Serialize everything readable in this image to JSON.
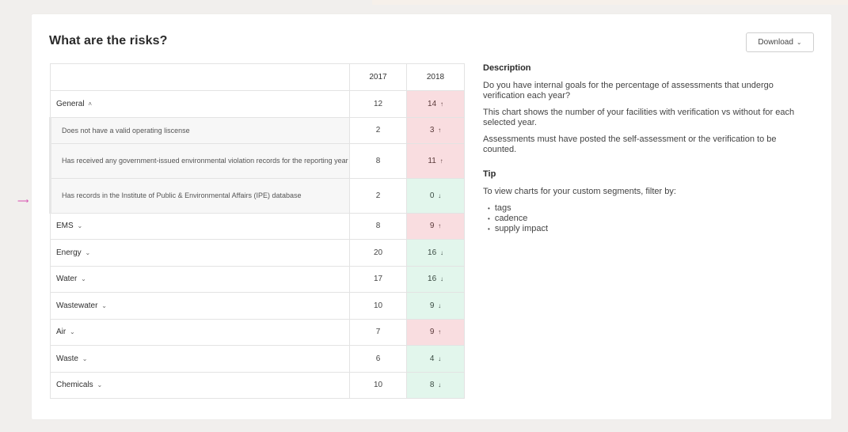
{
  "title": "What are the risks?",
  "download_label": "Download",
  "years": [
    "2017",
    "2018"
  ],
  "rows": [
    {
      "label": "General",
      "type": "cat",
      "expanded": true,
      "v2017": "12",
      "v2018": "14",
      "trend": "up"
    },
    {
      "label": "Does not have a valid operating liscense",
      "type": "sub",
      "v2017": "2",
      "v2018": "3",
      "trend": "up"
    },
    {
      "label": "Has received any government-issued environmental violation records for the reporting year",
      "type": "sub",
      "v2017": "8",
      "v2018": "11",
      "trend": "up"
    },
    {
      "label": "Has records in the Institute of Public & Environmental Affairs (IPE) database",
      "type": "sub",
      "v2017": "2",
      "v2018": "0",
      "trend": "down"
    },
    {
      "label": "EMS",
      "type": "cat",
      "expanded": false,
      "v2017": "8",
      "v2018": "9",
      "trend": "up"
    },
    {
      "label": "Energy",
      "type": "cat",
      "expanded": false,
      "v2017": "20",
      "v2018": "16",
      "trend": "down"
    },
    {
      "label": "Water",
      "type": "cat",
      "expanded": false,
      "v2017": "17",
      "v2018": "16",
      "trend": "down"
    },
    {
      "label": "Wastewater",
      "type": "cat",
      "expanded": false,
      "v2017": "10",
      "v2018": "9",
      "trend": "down"
    },
    {
      "label": "Air",
      "type": "cat",
      "expanded": false,
      "v2017": "7",
      "v2018": "9",
      "trend": "up"
    },
    {
      "label": "Waste",
      "type": "cat",
      "expanded": false,
      "v2017": "6",
      "v2018": "4",
      "trend": "down"
    },
    {
      "label": "Chemicals",
      "type": "cat",
      "expanded": false,
      "v2017": "10",
      "v2018": "8",
      "trend": "down"
    }
  ],
  "description": {
    "heading": "Description",
    "p1": "Do you have internal goals for the percentage of assessments that undergo verification each year?",
    "p2": "This chart shows the number of your facilities with verification vs without for each selected year.",
    "p3": "Assessments must have posted the self-assessment or the verification to be counted."
  },
  "tip": {
    "heading": "Tip",
    "text": "To view charts for your custom segments, filter by:",
    "items": [
      "tags",
      "cadence",
      "supply impact"
    ]
  },
  "colors": {
    "up": "#f9dde0",
    "down": "#e2f6ec",
    "marker": "#d64fb0"
  },
  "icons": {
    "up": "arrow-up-icon",
    "down": "arrow-down-icon",
    "expanded": "chevron-up-icon",
    "collapsed": "chevron-down-icon"
  }
}
